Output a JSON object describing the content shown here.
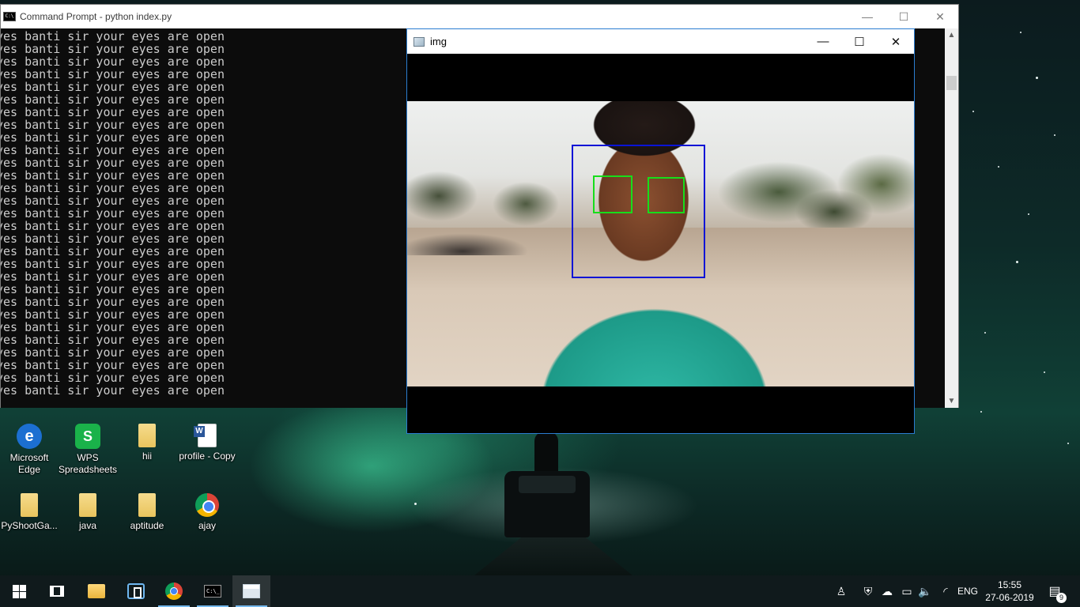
{
  "cmd_window": {
    "title": "Command Prompt - python  index.py",
    "icon": "cmd-icon",
    "output_line": "yes banti sir your eyes are open",
    "line_count": 29
  },
  "img_window": {
    "title": "img",
    "icon": "image-window-icon",
    "detections": {
      "face_box_color": "#0a14d6",
      "eye_box_color": "#17dd1b",
      "face_count": 1,
      "eye_count": 2
    }
  },
  "window_controls": {
    "minimize": "—",
    "maximize": "☐",
    "close": "✕"
  },
  "desktop_icons": [
    {
      "label": "Microsoft Edge",
      "icon": "edge-icon",
      "glyph": "e"
    },
    {
      "label": "WPS Spreadsheets",
      "icon": "wps-spreadsheets-icon",
      "glyph": "S"
    },
    {
      "label": "hii",
      "icon": "folder-icon",
      "glyph": ""
    },
    {
      "label": "profile - Copy",
      "icon": "word-document-icon",
      "glyph": ""
    },
    {
      "label": "PyShootGa...",
      "icon": "folder-icon",
      "glyph": ""
    },
    {
      "label": "java",
      "icon": "folder-icon",
      "glyph": ""
    },
    {
      "label": "aptitude",
      "icon": "folder-icon",
      "glyph": ""
    },
    {
      "label": "ajay",
      "icon": "chrome-icon",
      "glyph": ""
    }
  ],
  "taskbar": {
    "language": "ENG",
    "time": "15:55",
    "date": "27-06-2019",
    "notification_count": "9",
    "tray_people_icon": "♙",
    "tray_volume_icon": "🔈",
    "tray_network_icon": "◜",
    "tray_battery_icon": "▭",
    "accent_color": "#76b9ed"
  }
}
